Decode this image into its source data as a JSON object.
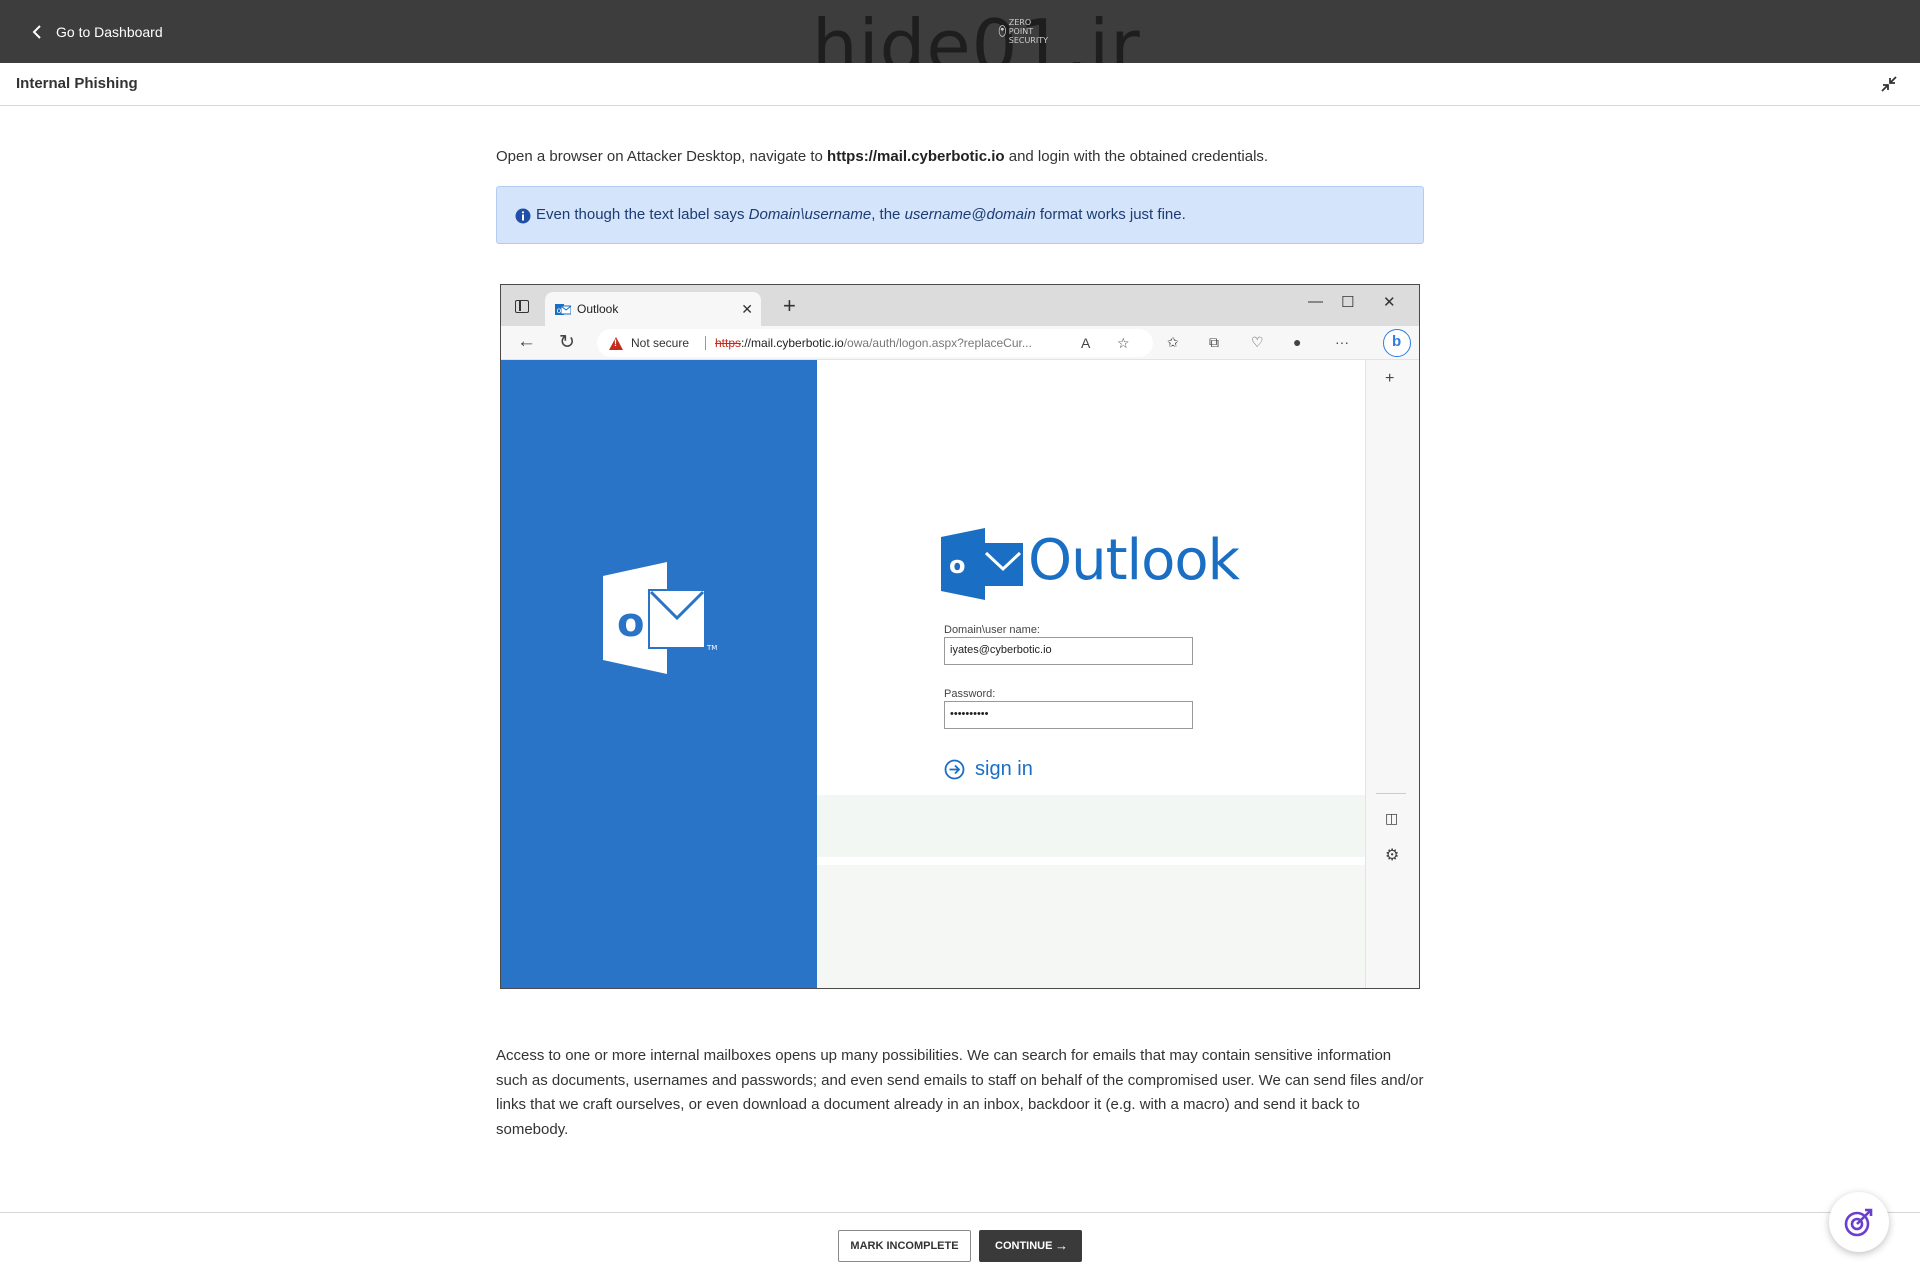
{
  "topbar": {
    "back_label": "Go to Dashboard",
    "watermark": "hide01.ir",
    "brand_text": [
      "ZERO",
      "POINT",
      "SECURITY"
    ]
  },
  "header": {
    "title": "Internal Phishing"
  },
  "content": {
    "intro_prefix": "Open a browser on Attacker Desktop, navigate to ",
    "intro_url": "https://mail.cyberbotic.io",
    "intro_suffix": " and login with the obtained credentials.",
    "callout": {
      "t1": "Even though the text label says ",
      "e1": "Domain\\username",
      "t2": ", the ",
      "e2": "username@domain",
      "t3": " format works just fine."
    },
    "paragraph": "Access to one or more internal mailboxes opens up many possibilities. We can search for emails that may contain sensitive information such as documents, usernames and passwords; and even send emails to staff on behalf of the compromised user. We can send files and/or links that we craft ourselves, or even download a document already in an inbox, backdoor it (e.g. with a macro) and send it back to somebody."
  },
  "browser": {
    "tab_title": "Outlook",
    "security_label": "Not secure",
    "url_scheme": "https",
    "url_host": "://mail.cyberbotic.io",
    "url_path": "/owa/auth/logon.aspx?replaceCur...",
    "owa": {
      "brand": "Outlook",
      "trademark": "TM",
      "user_label": "Domain\\user name:",
      "user_value": "iyates@cyberbotic.io",
      "password_label": "Password:",
      "password_value": "••••••••••",
      "signin_label": "sign in"
    }
  },
  "footer": {
    "mark_incomplete": "MARK INCOMPLETE",
    "continue": "CONTINUE",
    "continue_arrow": "→"
  },
  "colors": {
    "topbar": "#3d3d3d",
    "callout_bg": "#d4e4fb",
    "outlook_blue": "#2a74c7",
    "accent_purple": "#6a3fd0"
  }
}
